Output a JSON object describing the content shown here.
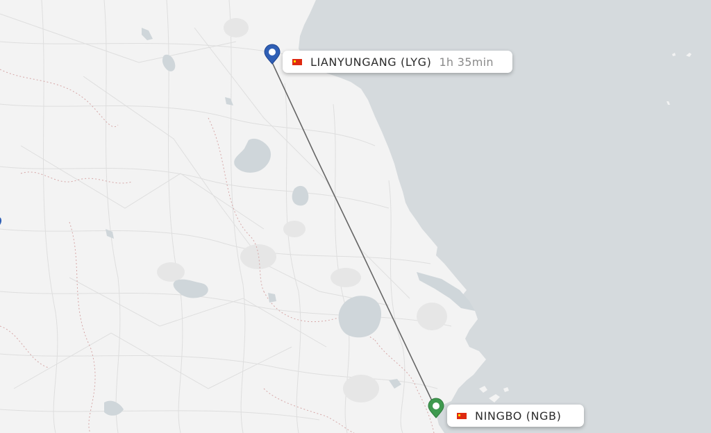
{
  "map": {
    "colors": {
      "land": "#f3f3f3",
      "sea": "#d5dadd",
      "roads": "#dedede",
      "lakes": "#cfd6da",
      "province_borders": "#d6a7a7",
      "route_line": "#666666",
      "origin_marker": "#2f5fb5",
      "destination_marker": "#3f9a4f"
    }
  },
  "route": {
    "origin": {
      "name": "LIANYUNGANG (LYG)",
      "flag": "china-flag-icon",
      "marker": "map-pin-icon"
    },
    "destination": {
      "name": "NINGBO (NGB)",
      "flag": "china-flag-icon",
      "marker": "map-pin-icon"
    },
    "duration": "1h 35min"
  }
}
